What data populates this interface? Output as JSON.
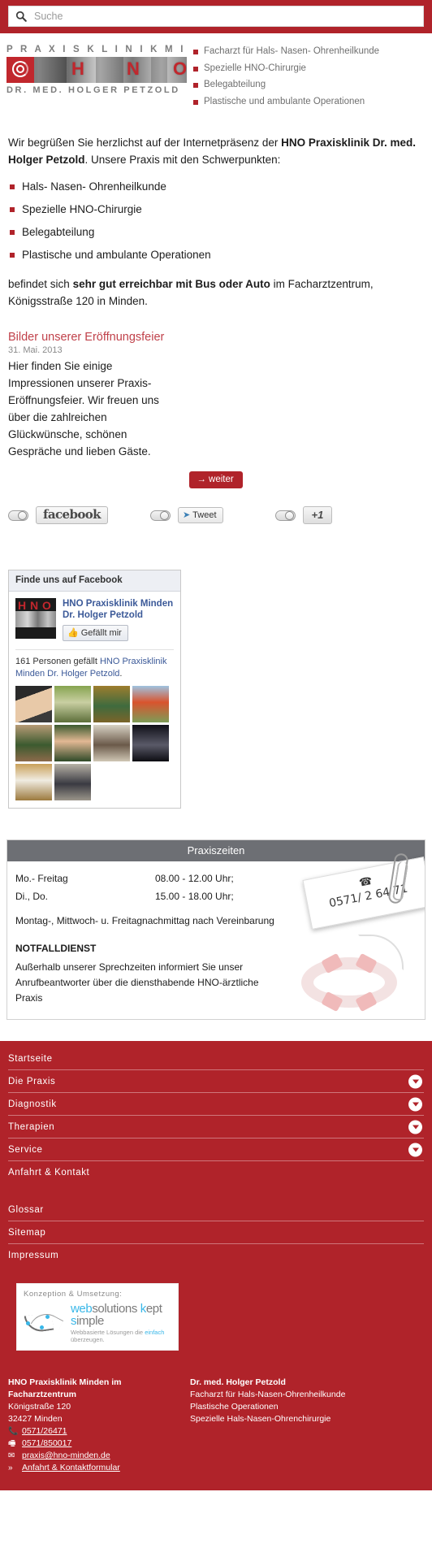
{
  "search": {
    "placeholder": "Suche",
    "icon": "search-icon"
  },
  "header": {
    "brand_line1": "P R A X I S K L I N I K   M I N D E N",
    "brand_line2": "DR. MED. HOLGER PETZOLD",
    "logo_letters": [
      "H",
      "N",
      "O"
    ],
    "specialties": [
      "Facharzt für Hals- Nasen- Ohrenheilkunde",
      "Spezielle HNO-Chirurgie",
      "Belegabteilung",
      "Plastische und ambulante Operationen"
    ]
  },
  "main": {
    "intro_part1": "Wir begrüßen Sie herzlichst auf der Internetpräsenz der ",
    "intro_bold": "HNO Praxisklinik Dr. med. Holger Petzold",
    "intro_part2": ". Unsere Praxis mit den Schwerpunkten:",
    "focus_list": [
      "Hals- Nasen- Ohrenheilkunde",
      "Spezielle HNO-Chirurgie",
      "Belegabteilung",
      "Plastische und ambulante Operationen"
    ],
    "after_part1": "befindet sich ",
    "after_bold": "sehr gut erreichbar mit Bus oder Auto",
    "after_part2": " im Facharztzentrum, Königsstraße 120 in Minden."
  },
  "news": {
    "title": "Bilder unserer Eröffnungsfeier",
    "date": "31. Mai. 2013",
    "body": "Hier finden Sie einige Impressionen unserer Praxis-Eröffnungsfeier. Wir freuen uns über die zahlreichen Glückwünsche, schönen Gespräche und lieben Gäste.",
    "more_label": "→ weiter"
  },
  "social": {
    "facebook_label": "facebook",
    "twitter_label": "Tweet",
    "googleplus_label": "+1"
  },
  "facebook_widget": {
    "header": "Finde uns auf Facebook",
    "page_name": "HNO Praxisklinik Minden Dr. Holger Petzold",
    "like_label": "Gefällt mir",
    "like_count_prefix": "161 Personen gefällt ",
    "like_count_link": "HNO Praxisklinik Minden Dr. Holger Petzold",
    "like_count_suffix": ".",
    "logo_letters": [
      "H",
      "N",
      "O"
    ]
  },
  "hours": {
    "heading": "Praxiszeiten",
    "rows": [
      {
        "days": "Mo.- Freitag",
        "time": "08.00 - 12.00 Uhr;"
      },
      {
        "days": "Di., Do.",
        "time": "15.00 - 18.00 Uhr;"
      }
    ],
    "note": "Montag-, Mittwoch- u. Freitagnachmittag nach Vereinbarung",
    "emergency_title": "NOTFALLDIENST",
    "emergency_body": "Außerhalb unserer Sprechzeiten informiert Sie unser Anrufbeantworter über die diensthabende HNO-ärztliche Praxis",
    "sticky_phone": "0571/ 2 64 71",
    "sticky_icon": "☎"
  },
  "nav": {
    "items": [
      {
        "label": "Startseite",
        "expandable": false
      },
      {
        "label": "Die Praxis",
        "expandable": true
      },
      {
        "label": "Diagnostik",
        "expandable": true
      },
      {
        "label": "Therapien",
        "expandable": true
      },
      {
        "label": "Service",
        "expandable": true
      },
      {
        "label": "Anfahrt & Kontakt",
        "expandable": false
      },
      {
        "label": "Glossar",
        "expandable": false
      },
      {
        "label": "Sitemap",
        "expandable": false
      },
      {
        "label": "Impressum",
        "expandable": false
      }
    ]
  },
  "credit": {
    "top": "Konzeption & Umsetzung:",
    "name_blue1": "web",
    "name_gray1": "solutions ",
    "name_blue2": "k",
    "name_gray2": "ept ",
    "name_blue3": "s",
    "name_gray3": "imple",
    "sub_pre": "Webbasierte Lösungen die ",
    "sub_hl": "einfach",
    "sub_post": " überzeugen."
  },
  "footer": {
    "left": {
      "name_line1": "HNO Praxisklinik Minden im",
      "name_line2": "Facharztzentrum",
      "street": "Königstraße 120",
      "city": "32427 Minden",
      "phone": "0571/26471",
      "fax": "0571/850017",
      "email": "praxis@hno-minden.de",
      "contact_link": "Anfahrt & Kontaktformular",
      "phone_icon": "📞",
      "fax_icon": "🖷",
      "mail_icon": "✉",
      "arrow_icon": "»"
    },
    "right": {
      "doctor": "Dr. med. Holger Petzold",
      "lines": [
        "Facharzt für Hals-Nasen-Ohrenheilkunde",
        "Plastische Operationen",
        "Spezielle Hals-Nasen-Ohrenchirurgie"
      ]
    }
  },
  "colors": {
    "brand_red": "#b0232a",
    "heading_gray": "#6d6f74",
    "fb_blue": "#3b5998"
  }
}
